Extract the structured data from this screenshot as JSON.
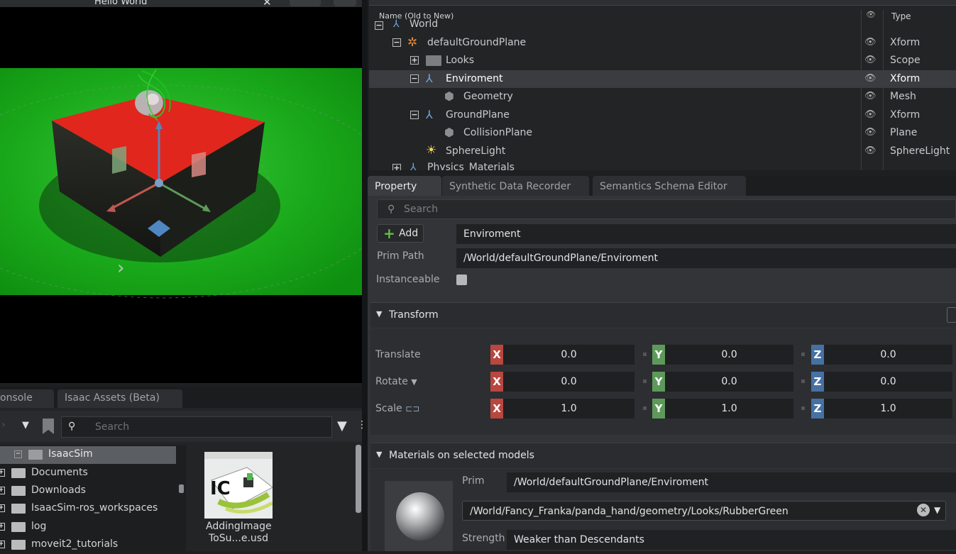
{
  "viewport": {
    "title": "Hello World",
    "close_icon": "close-icon"
  },
  "stage": {
    "col_name": "Name (Old to New)",
    "col_type": "Type",
    "rows": [
      {
        "label": "World",
        "type": "",
        "icon": "xform-icon"
      },
      {
        "label": "defaultGroundPlane",
        "type": "Xform",
        "icon": "ground-plane-icon"
      },
      {
        "label": "Looks",
        "type": "Scope",
        "icon": "folder-icon"
      },
      {
        "label": "Enviroment",
        "type": "Xform",
        "icon": "xform-icon"
      },
      {
        "label": "Geometry",
        "type": "Mesh",
        "icon": "mesh-icon"
      },
      {
        "label": "GroundPlane",
        "type": "Xform",
        "icon": "xform-icon"
      },
      {
        "label": "CollisionPlane",
        "type": "Plane",
        "icon": "mesh-icon"
      },
      {
        "label": "SphereLight",
        "type": "SphereLight",
        "icon": "light-icon"
      },
      {
        "label": "Physics_Materials",
        "type": "",
        "icon": "xform-icon"
      }
    ]
  },
  "property": {
    "tabs": [
      "Property",
      "Synthetic Data Recorder",
      "Semantics Schema Editor"
    ],
    "search_placeholder": "Search",
    "add_label": "Add",
    "prim_name": "Enviroment",
    "prim_path_label": "Prim Path",
    "prim_path": "/World/defaultGroundPlane/Enviroment",
    "instanceable_label": "Instanceable",
    "transform": {
      "title": "Transform",
      "translate_label": "Translate",
      "rotate_label": "Rotate",
      "scale_label": "Scale",
      "translate": [
        "0.0",
        "0.0",
        "0.0"
      ],
      "rotate": [
        "0.0",
        "0.0",
        "0.0"
      ],
      "scale": [
        "1.0",
        "1.0",
        "1.0"
      ],
      "axes": [
        "X",
        "Y",
        "Z"
      ]
    },
    "materials": {
      "title": "Materials on selected models",
      "prim_label": "Prim",
      "prim_value": "/World/defaultGroundPlane/Enviroment",
      "material_path": "/World/Fancy_Franka/panda_hand/geometry/Looks/RubberGreen",
      "strength_label": "Strength",
      "strength_value": "Weaker than Descendants"
    }
  },
  "console": {
    "tabs": [
      "onsole",
      "Isaac Assets (Beta)"
    ],
    "search_placeholder": "Search",
    "tree": [
      "IsaacSim",
      "Documents",
      "Downloads",
      "IsaacSim-ros_workspaces",
      "log",
      "moveit2_tutorials"
    ],
    "thumb_label_1": "AddingImage",
    "thumb_label_2": "ToSu...e.usd"
  },
  "colors": {
    "accent_x": "#b8473f",
    "accent_y": "#5d9a5a",
    "accent_z": "#4671a3",
    "ground": "#1fae1f",
    "cube_top": "#e1261e"
  }
}
